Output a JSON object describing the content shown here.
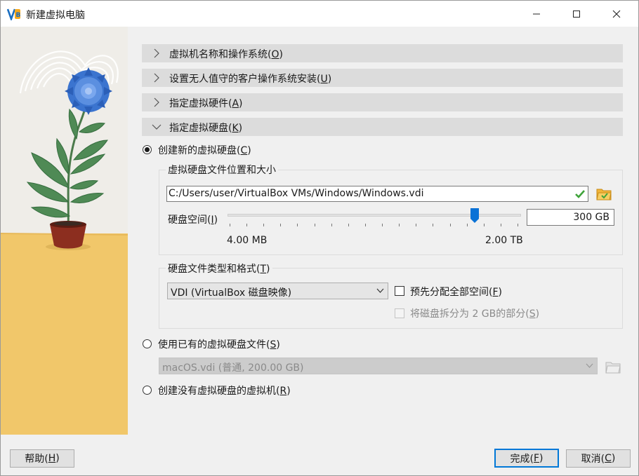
{
  "window": {
    "title": "新建虚拟电脑",
    "brand_color": "#1a6ec1"
  },
  "sections": [
    {
      "label": "虚拟机名称和操作系统(",
      "key": "O",
      "tail": ")",
      "state": "collapsed"
    },
    {
      "label": "设置无人值守的客户操作系统安装(",
      "key": "U",
      "tail": ")",
      "state": "collapsed"
    },
    {
      "label": "指定虚拟硬件(",
      "key": "A",
      "tail": ")",
      "state": "collapsed"
    },
    {
      "label": "指定虚拟硬盘(",
      "key": "K",
      "tail": ")",
      "state": "expanded"
    }
  ],
  "disk": {
    "create_new": {
      "label": "创建新的虚拟硬盘(",
      "key": "C",
      "tail": ")",
      "selected": true
    },
    "location_group": {
      "title": "虚拟硬盘文件位置和大小",
      "path": "C:/Users/user/VirtualBox VMs/Windows/Windows.vdi",
      "size_label": "硬盘空间(",
      "size_key": "I",
      "size_tail": ")",
      "size_value": "300 GB",
      "slider_min": "4.00 MB",
      "slider_max": "2.00 TB",
      "slider_fraction": 0.85
    },
    "format_group": {
      "title": "硬盘文件类型和格式(",
      "title_key": "T",
      "title_tail": ")",
      "format_value": "VDI (VirtualBox 磁盘映像)",
      "preallocate": {
        "label": "预先分配全部空间(",
        "key": "F",
        "tail": ")",
        "checked": false
      },
      "split": {
        "label": "将磁盘拆分为 2 GB的部分(",
        "key": "S",
        "tail": ")",
        "checked": false,
        "enabled": false
      }
    },
    "use_existing": {
      "label": "使用已有的虚拟硬盘文件(",
      "key": "S",
      "tail": ")",
      "selected": false,
      "file_value": "macOS.vdi (普通, 200.00 GB)"
    },
    "no_disk": {
      "label": "创建没有虚拟硬盘的虚拟机(",
      "key": "R",
      "tail": ")",
      "selected": false
    }
  },
  "footer": {
    "help": {
      "label": "帮助(",
      "key": "H",
      "tail": ")"
    },
    "finish": {
      "label": "完成(",
      "key": "F",
      "tail": ")"
    },
    "cancel": {
      "label": "取消(",
      "key": "C",
      "tail": ")"
    }
  },
  "icons": {
    "valid": "check-icon",
    "folder": "folder-icon",
    "dropdown": "chevron-down-icon",
    "collapsed": "chevron-right-icon",
    "expanded": "chevron-down-icon"
  }
}
